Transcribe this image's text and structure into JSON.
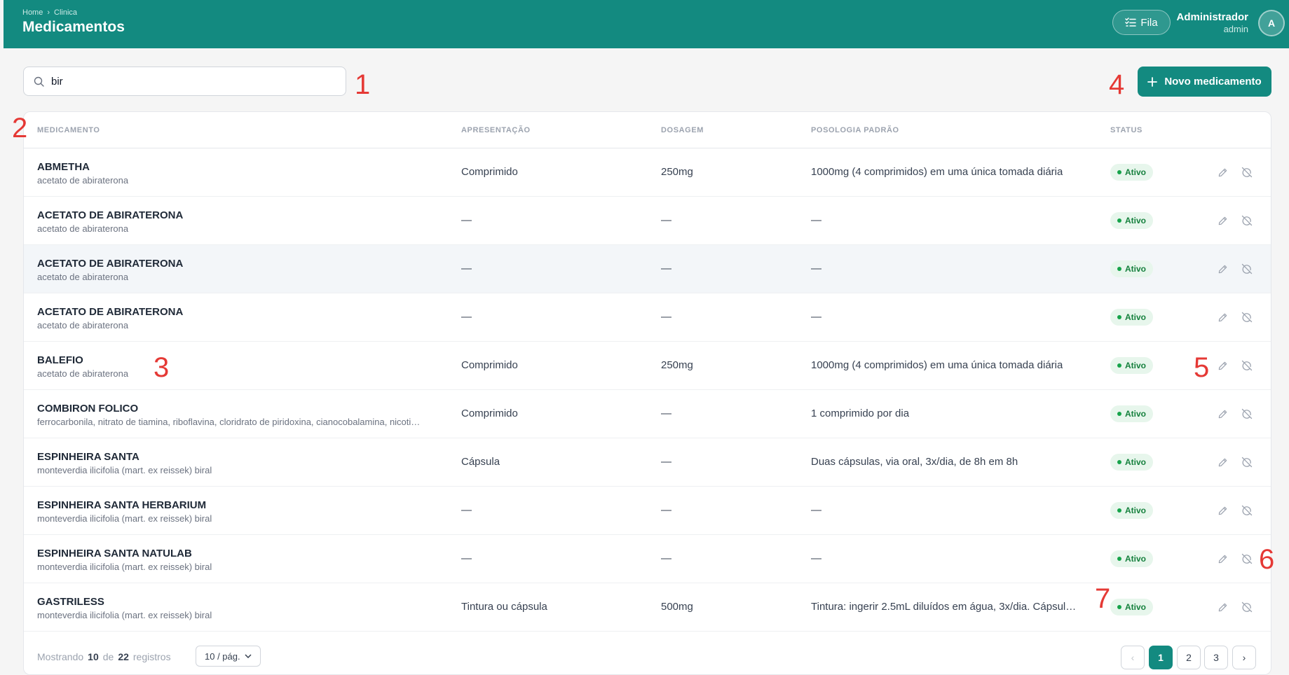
{
  "header": {
    "breadcrumb": [
      "Home",
      "›",
      "Clinica"
    ],
    "title": "Medicamentos",
    "queue_button": "Fila",
    "user_name": "Administrador",
    "user_role": "admin",
    "avatar_initial": "A"
  },
  "search": {
    "value": "bir"
  },
  "new_button": {
    "label": "Novo medicamento",
    "icon": "plus-icon"
  },
  "annotations": [
    "1",
    "2",
    "3",
    "4",
    "5",
    "6",
    "7"
  ],
  "table": {
    "columns": [
      "MEDICAMENTO",
      "APRESENTAÇÃO",
      "DOSAGEM",
      "POSOLOGIA PADRÃO",
      "STATUS"
    ],
    "rows": [
      {
        "name": "ABMETHA",
        "sub": "acetato de abiraterona",
        "apresentacao": "Comprimido",
        "dosagem": "250mg",
        "posologia": "1000mg (4 comprimidos) em uma única tomada diária",
        "status": "Ativo"
      },
      {
        "name": "ACETATO DE ABIRATERONA",
        "sub": "acetato de abiraterona",
        "apresentacao": "—",
        "dosagem": "—",
        "posologia": "—",
        "status": "Ativo"
      },
      {
        "name": "ACETATO DE ABIRATERONA",
        "sub": "acetato de abiraterona",
        "apresentacao": "—",
        "dosagem": "—",
        "posologia": "—",
        "status": "Ativo"
      },
      {
        "name": "ACETATO DE ABIRATERONA",
        "sub": "acetato de abiraterona",
        "apresentacao": "—",
        "dosagem": "—",
        "posologia": "—",
        "status": "Ativo"
      },
      {
        "name": "BALEFIO",
        "sub": "acetato de abiraterona",
        "apresentacao": "Comprimido",
        "dosagem": "250mg",
        "posologia": "1000mg (4 comprimidos) em uma única tomada diária",
        "status": "Ativo"
      },
      {
        "name": "COMBIRON FOLICO",
        "sub": "ferrocarbonila, nitrato de tiamina, riboflavina, cloridrato de piridoxina, cianocobalamina, nicoti…",
        "apresentacao": "Comprimido",
        "dosagem": "—",
        "posologia": "1 comprimido por dia",
        "status": "Ativo"
      },
      {
        "name": "ESPINHEIRA SANTA",
        "sub": "monteverdia ilicifolia (mart. ex reissek) biral",
        "apresentacao": "Cápsula",
        "dosagem": "—",
        "posologia": "Duas cápsulas, via oral, 3x/dia, de 8h em 8h",
        "status": "Ativo"
      },
      {
        "name": "ESPINHEIRA SANTA HERBARIUM",
        "sub": "monteverdia ilicifolia (mart. ex reissek) biral",
        "apresentacao": "—",
        "dosagem": "—",
        "posologia": "—",
        "status": "Ativo"
      },
      {
        "name": "ESPINHEIRA SANTA NATULAB",
        "sub": "monteverdia ilicifolia (mart. ex reissek) biral",
        "apresentacao": "—",
        "dosagem": "—",
        "posologia": "—",
        "status": "Ativo"
      },
      {
        "name": "GASTRILESS",
        "sub": "monteverdia ilicifolia (mart. ex reissek) biral",
        "apresentacao": "Tintura ou cápsula",
        "dosagem": "500mg",
        "posologia": "Tintura: ingerir 2.5mL diluídos em água, 3x/dia. Cápsul…",
        "status": "Ativo"
      }
    ]
  },
  "footer": {
    "showing": "Mostrando",
    "count": "10",
    "of": "de",
    "total": "22",
    "records": "registros",
    "page_size": "10 / pág.",
    "pages": [
      "1",
      "2",
      "3"
    ],
    "current_page": "1",
    "prev": "‹",
    "next": "›"
  },
  "colors": {
    "brand": "#138a80",
    "status_active": "#15803d",
    "annotation": "#e53935"
  }
}
